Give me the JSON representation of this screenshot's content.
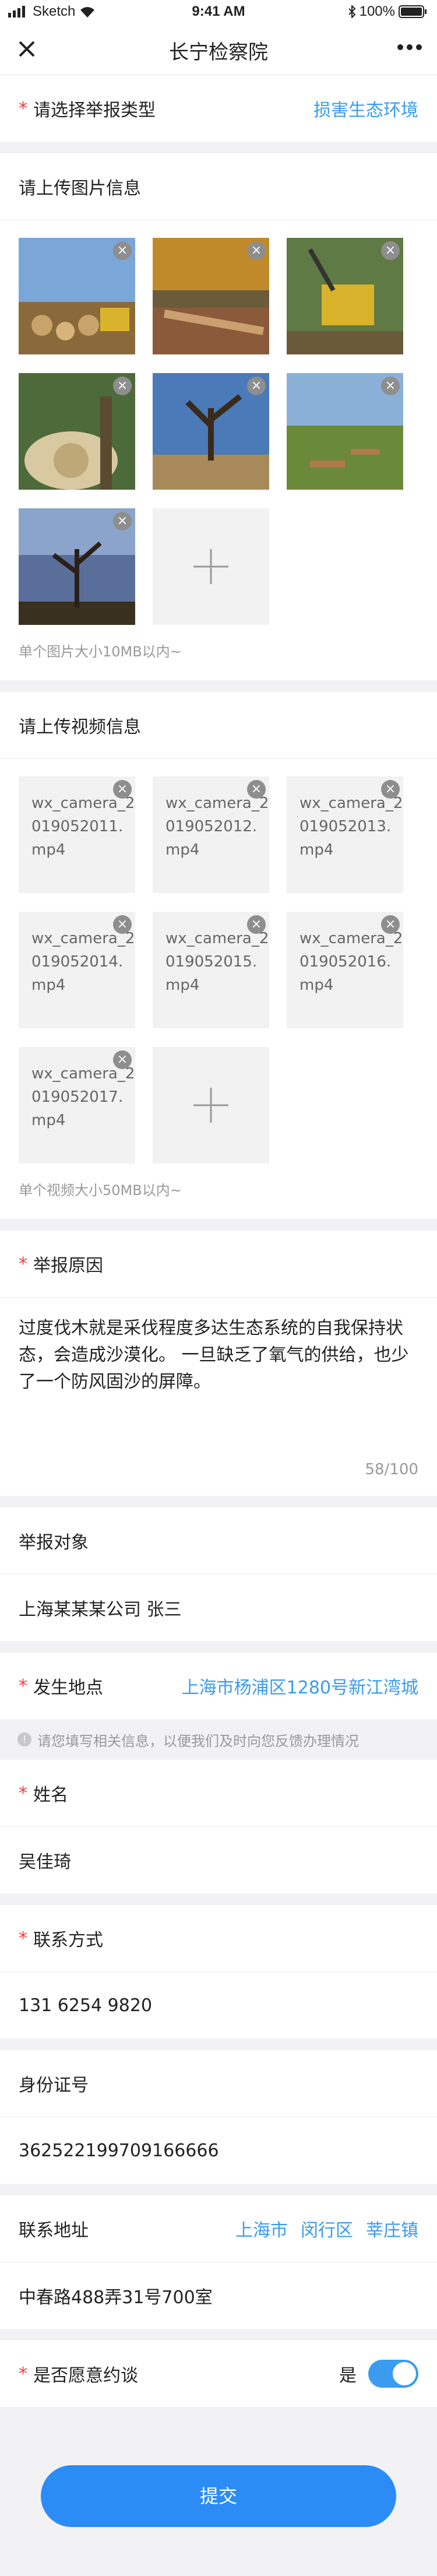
{
  "status_bar": {
    "carrier": "Sketch",
    "time": "9:41 AM",
    "battery": "100%"
  },
  "nav": {
    "title": "长宁检察院"
  },
  "report_type": {
    "label": "请选择举报类型",
    "value": "损害生态环境"
  },
  "images": {
    "title": "请上传图片信息",
    "hint": "单个图片大小10MB以内~",
    "count": 7
  },
  "videos": {
    "title": "请上传视频信息",
    "hint": "单个视频大小50MB以内~",
    "items": [
      "wx_camera_2019052011.mp4",
      "wx_camera_2019052012.mp4",
      "wx_camera_2019052013.mp4",
      "wx_camera_2019052014.mp4",
      "wx_camera_2019052015.mp4",
      "wx_camera_2019052016.mp4",
      "wx_camera_2019052017.mp4"
    ]
  },
  "reason": {
    "label": "举报原因",
    "text": "过度伐木就是采伐程度多达生态系统的自我保持状态，会造成沙漠化。 一旦缺乏了氧气的供给，也少了一个防风固沙的屏障。",
    "counter": "58/100"
  },
  "target": {
    "label": "举报对象",
    "value": "上海某某某公司 张三"
  },
  "location": {
    "label": "发生地点",
    "value": "上海市杨浦区1280号新江湾城"
  },
  "note": "请您填写相关信息，以便我们及时向您反馈办理情况",
  "name": {
    "label": "姓名",
    "value": "吴佳琦"
  },
  "contact": {
    "label": "联系方式",
    "value": "131 6254 9820"
  },
  "id_card": {
    "label": "身份证号",
    "value": "362522199709166666"
  },
  "address": {
    "label": "联系地址",
    "city": "上海市",
    "district": "闵行区",
    "town": "莘庄镇",
    "detail": "中春路488弄31号700室"
  },
  "interview": {
    "label": "是否愿意约谈",
    "value": "是",
    "on": true
  },
  "submit_label": "提交",
  "colors": {
    "accent": "#3a9bf0",
    "required": "#f23b3b",
    "button": "#2b8cf5"
  }
}
